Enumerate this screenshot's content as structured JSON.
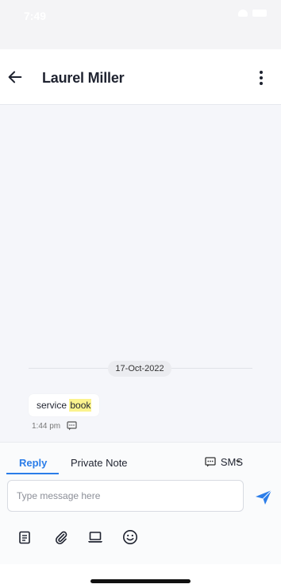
{
  "status_bar": {
    "time": "7:49"
  },
  "header": {
    "title": "Laurel Miller"
  },
  "chat": {
    "date_label": "17-Oct-2022",
    "messages": [
      {
        "text_before": "service ",
        "text_highlight": "book",
        "time": "1:44 pm"
      }
    ]
  },
  "composer": {
    "tabs": [
      {
        "label": "Reply",
        "active": true
      },
      {
        "label": "Private Note",
        "active": false
      }
    ],
    "channel_label": "SMS",
    "input_placeholder": "Type message here"
  },
  "colors": {
    "accent": "#2b7de9",
    "highlight": "#fbf38e",
    "chat_background": "#f5f6fa"
  },
  "icons": [
    "back-arrow-icon",
    "more-vertical-icon",
    "sms-message-icon",
    "send-icon",
    "article-icon",
    "paperclip-icon",
    "laptop-icon",
    "smiley-icon"
  ]
}
